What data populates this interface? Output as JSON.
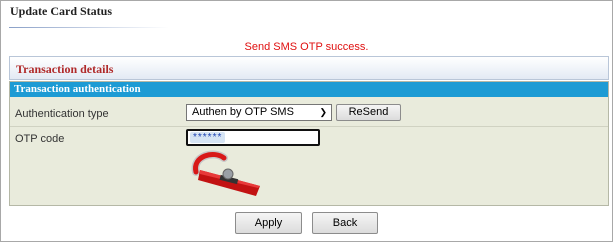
{
  "page_title": "Update Card Status",
  "status_message": "Send SMS OTP success.",
  "transaction_details": {
    "title": "Transaction details"
  },
  "authentication": {
    "title": "Transaction authentication",
    "type_label": "Authentication type",
    "type_value": "Authen by OTP SMS",
    "resend_label": "ReSend",
    "otp_label": "OTP code",
    "otp_value": "******"
  },
  "actions": {
    "apply_label": "Apply",
    "back_label": "Back"
  },
  "colors": {
    "status": "#e01010",
    "header_accent": "#b02a2a",
    "auth_bar": "#1d9bd4",
    "panel": "#e9ebdc"
  },
  "icons": {
    "token": "otp-token-device-icon",
    "dropdown": "chevron-down-icon"
  }
}
